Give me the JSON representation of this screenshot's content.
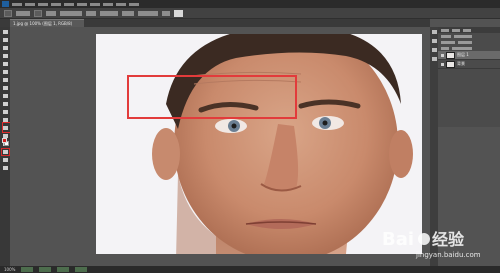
{
  "document_tab": {
    "title": "1.jpg @ 100% (图层 1, RGB/8)"
  },
  "toolbar": {
    "selected_tool": "healing-brush",
    "foreground_color": "#d12020",
    "background_color": "#ffffff"
  },
  "layers": [
    {
      "name": "图层 1",
      "active": true
    },
    {
      "name": "背景",
      "active": false
    }
  ],
  "status": {
    "zoom": "100%"
  },
  "annotation": {
    "highlight_color": "#e23b3b"
  },
  "watermark": {
    "text": "Bai 经验",
    "url": "jingyan.baidu.com"
  }
}
